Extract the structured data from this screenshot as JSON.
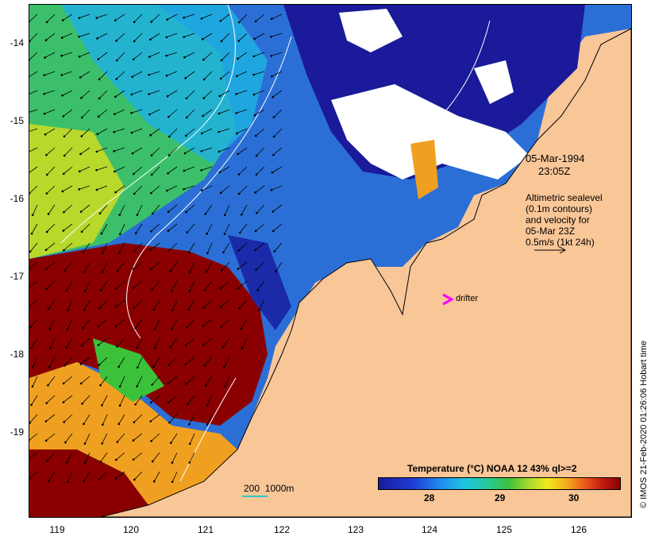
{
  "map": {
    "date": "05-Mar-1994",
    "time": "23:05Z",
    "altimetry_legend": [
      "Altimetric sealevel",
      "(0.1m contours)",
      "and velocity for",
      "05-Mar 23Z",
      "0.5m/s (1kt 24h)"
    ],
    "drifter_label": "drifter",
    "scale_label": "200  1000m",
    "colorbar": {
      "title": "Temperature (°C) NOAA 12 43% ql>=2",
      "ticks": [
        "28",
        "29",
        "30"
      ]
    },
    "timestamp": "© IMOS 21-Feb-2020 01:26:06 Hobart time",
    "lat_ticks": [
      "-14",
      "-15",
      "-16",
      "-17",
      "-18",
      "-19"
    ],
    "lon_ticks": [
      "119",
      "120",
      "121",
      "122",
      "123",
      "124",
      "125",
      "126"
    ],
    "colors": {
      "land": "#f9c698",
      "warm": "#8a0000",
      "cold": "#1a1a9a",
      "drifter": "#ff00ff",
      "contour": "#ffffff",
      "scale_line": "#2ec8c8"
    }
  }
}
